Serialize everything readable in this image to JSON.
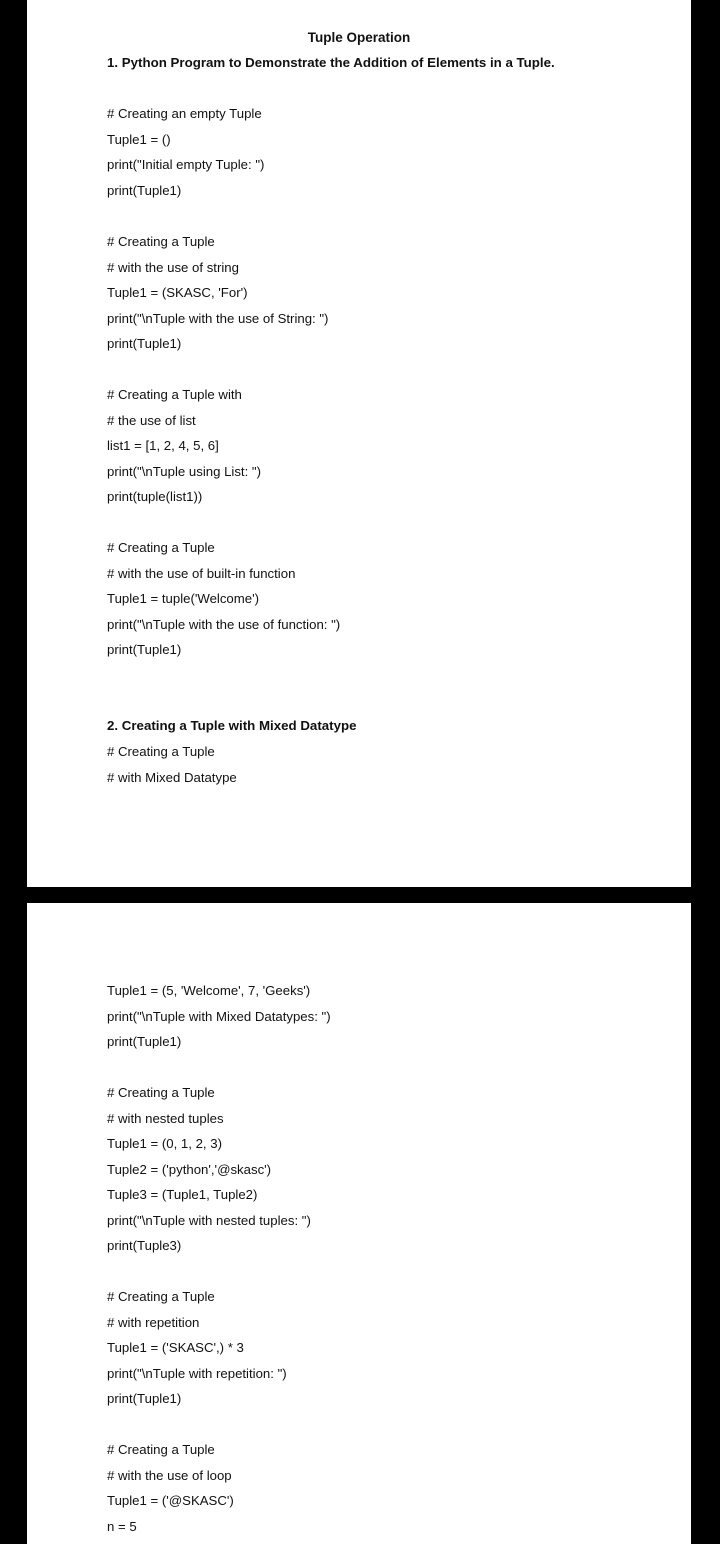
{
  "page1": {
    "title": "Tuple Operation",
    "heading1": "1. Python Program to Demonstrate the Addition of Elements in a Tuple.",
    "block1": [
      "# Creating an empty Tuple",
      "Tuple1 = ()",
      "print(\"Initial empty Tuple: \")",
      "print(Tuple1)"
    ],
    "block2": [
      "# Creating a Tuple",
      "# with the use of string",
      "Tuple1 = (SKASC, 'For')",
      "print(\"\\nTuple with the use of String: \")",
      "print(Tuple1)"
    ],
    "block3": [
      "# Creating a Tuple with",
      "# the use of list",
      "list1 = [1, 2, 4, 5, 6]",
      "print(\"\\nTuple using List: \")",
      "print(tuple(list1))"
    ],
    "block4": [
      "# Creating a Tuple",
      "# with the use of built-in function",
      "Tuple1 = tuple('Welcome')",
      "print(\"\\nTuple with the use of function: \")",
      "print(Tuple1)"
    ],
    "heading2": "2. Creating a Tuple with Mixed Datatype",
    "block5": [
      "# Creating a Tuple",
      "# with Mixed Datatype"
    ]
  },
  "page2": {
    "block1": [
      "Tuple1 = (5, 'Welcome', 7, 'Geeks')",
      "print(\"\\nTuple with Mixed Datatypes: \")",
      "print(Tuple1)"
    ],
    "block2": [
      "# Creating a Tuple",
      "# with nested tuples",
      "Tuple1 = (0, 1, 2, 3)",
      "Tuple2 = ('python','@skasc')",
      "Tuple3 = (Tuple1, Tuple2)",
      "print(\"\\nTuple with nested tuples: \")",
      "print(Tuple3)"
    ],
    "block3": [
      "# Creating a Tuple",
      "# with repetition",
      "Tuple1 = ('SKASC',) * 3",
      "print(\"\\nTuple with repetition: \")",
      "print(Tuple1)"
    ],
    "block4": [
      "# Creating a Tuple",
      "# with the use of loop",
      "Tuple1 = ('@SKASC')",
      "n = 5"
    ]
  }
}
